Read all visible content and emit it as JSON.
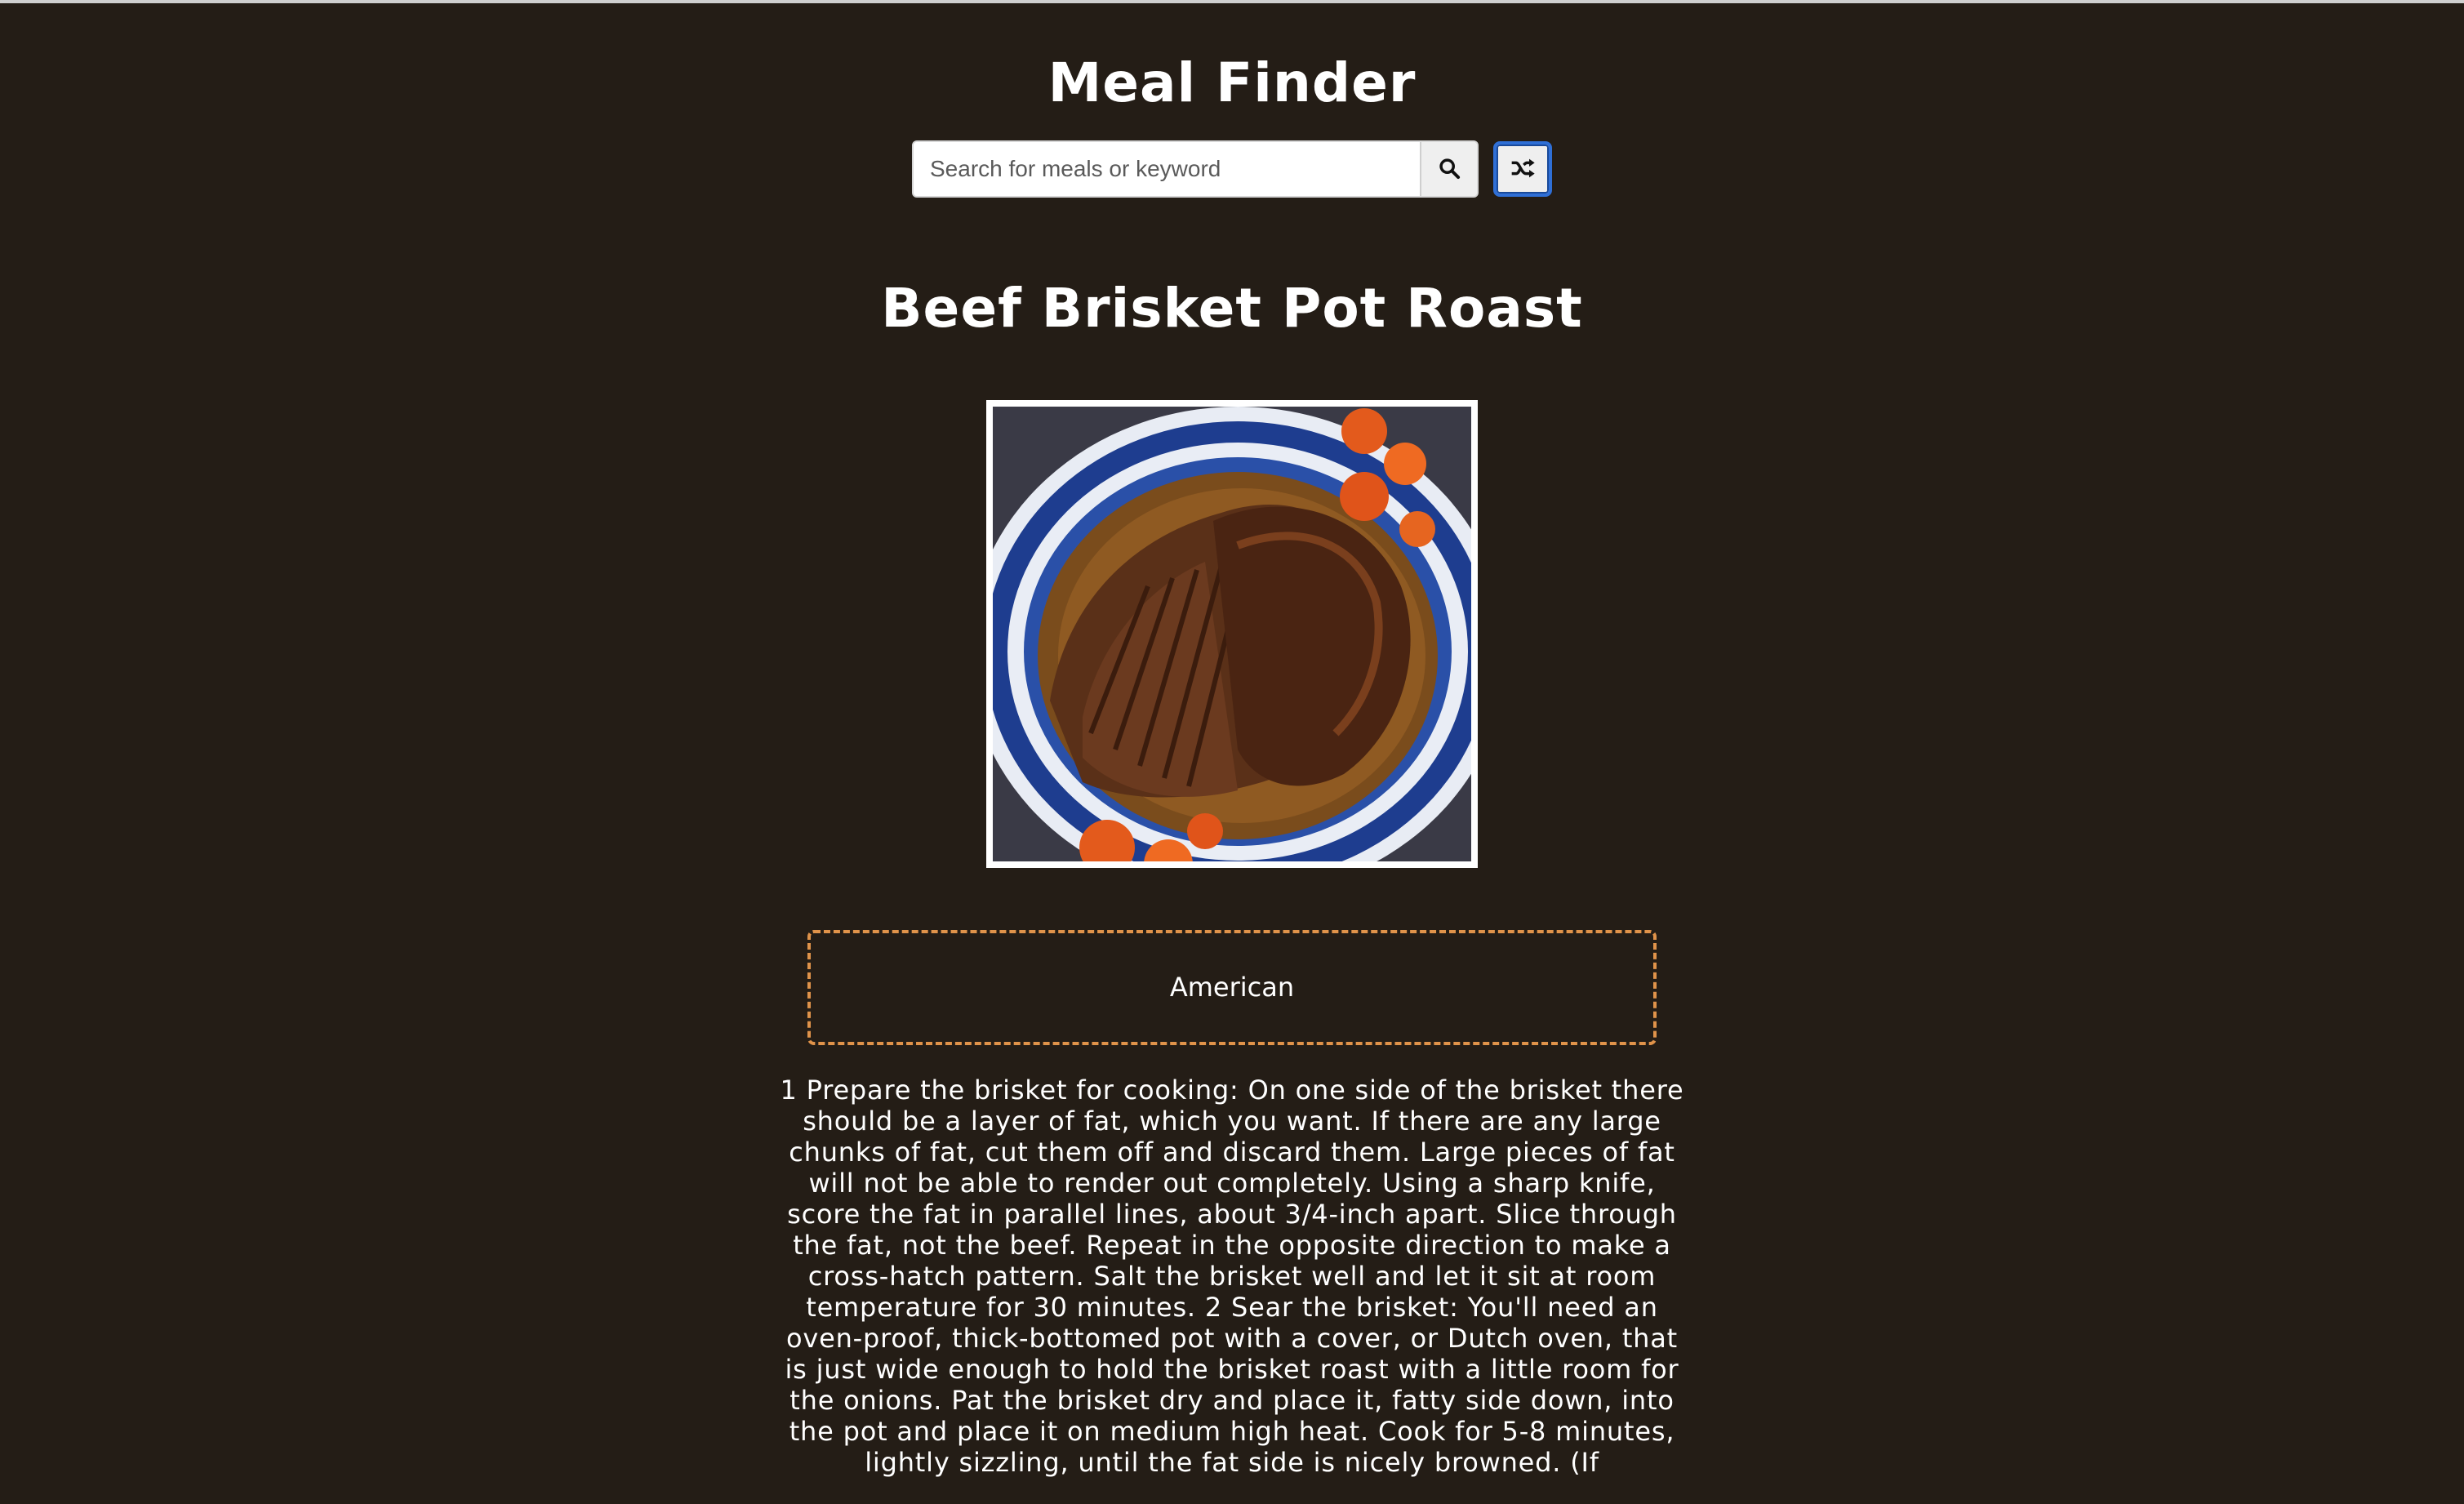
{
  "header": {
    "title": "Meal Finder"
  },
  "search": {
    "placeholder": "Search for meals or keyword",
    "value": "",
    "search_icon": "search-icon",
    "random_icon": "shuffle-icon"
  },
  "meal": {
    "title": "Beef Brisket Pot Roast",
    "category": "American",
    "instructions": "1 Prepare the brisket for cooking: On one side of the brisket there should be a layer of fat, which you want. If there are any large chunks of fat, cut them off and discard them. Large pieces of fat will not be able to render out completely. Using a sharp knife, score the fat in parallel lines, about 3/4-inch apart. Slice through the fat, not the beef. Repeat in the opposite direction to make a cross-hatch pattern. Salt the brisket well and let it sit at room temperature for 30 minutes. 2 Sear the brisket: You'll need an oven-proof, thick-bottomed pot with a cover, or Dutch oven, that is just wide enough to hold the brisket roast with a little room for the onions. Pat the brisket dry and place it, fatty side down, into the pot and place it on medium high heat. Cook for 5-8 minutes, lightly sizzling, until the fat side is nicely browned. (If"
  },
  "colors": {
    "background": "#241d16",
    "text": "#ffffff",
    "category_border": "#e0934a",
    "random_button_border": "#2f6fd6"
  }
}
